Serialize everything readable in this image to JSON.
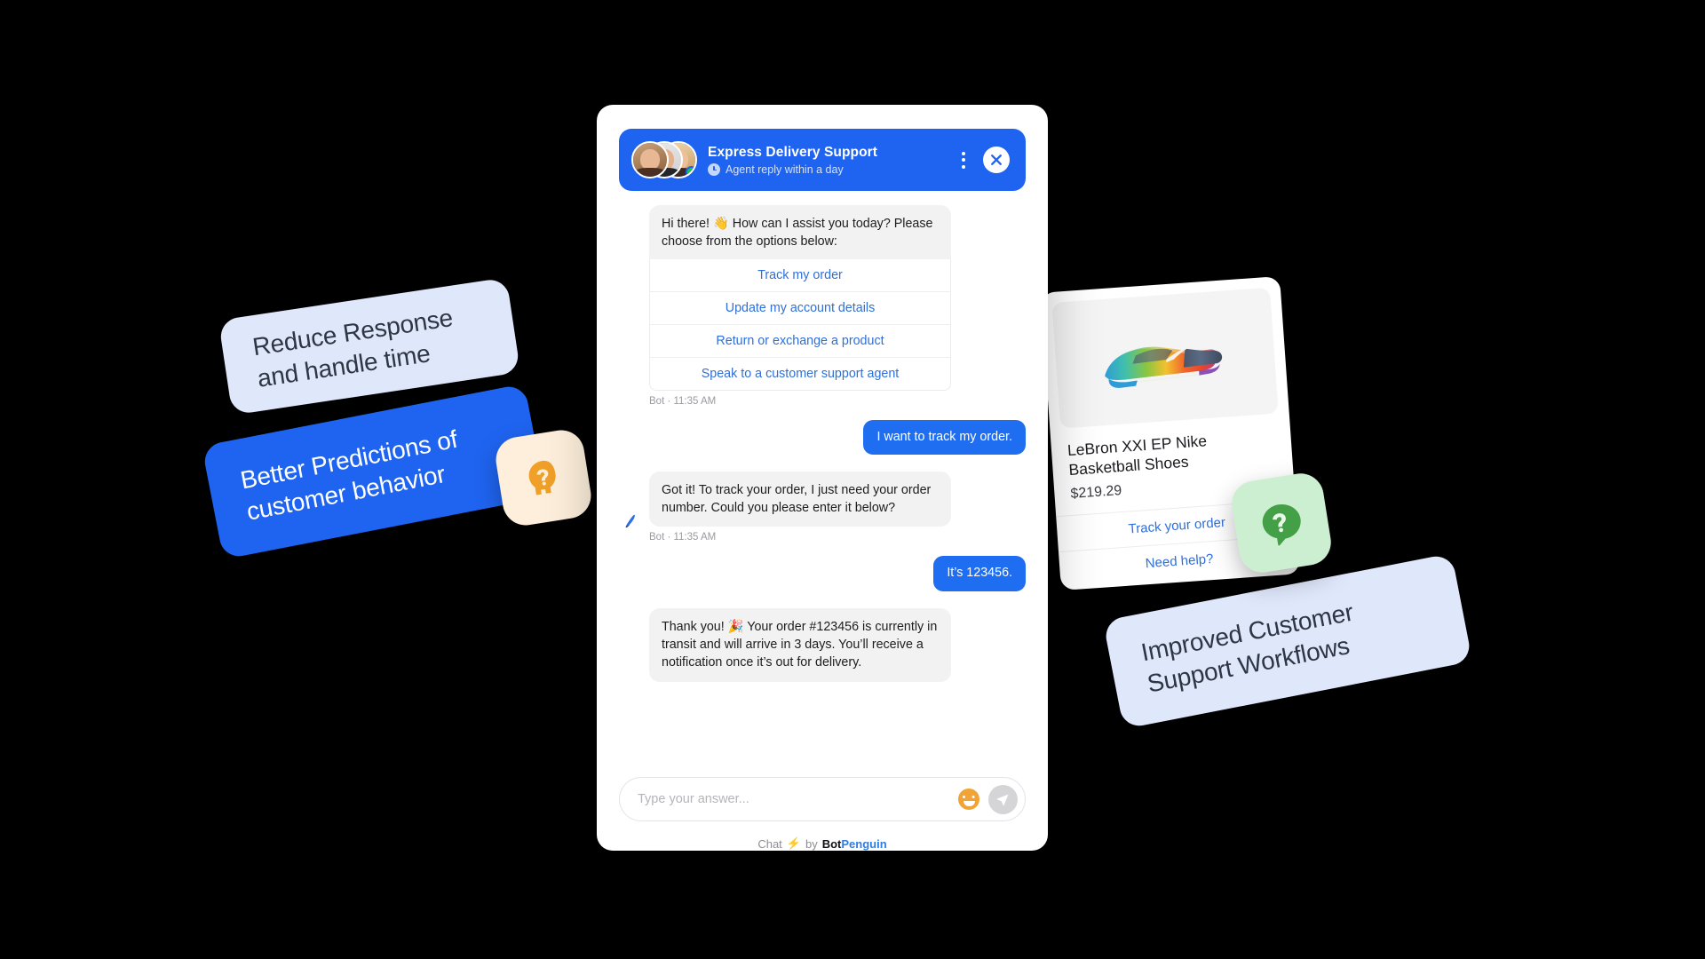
{
  "chat": {
    "header": {
      "title": "Express Delivery Support",
      "subtitle": "Agent reply within a day",
      "clock_icon": "clock-icon",
      "kebab_icon": "kebab-menu-icon",
      "close_icon": "close-icon",
      "avatars": [
        "agent-avatar-1",
        "agent-avatar-2",
        "agent-avatar-3"
      ],
      "online_status": "online",
      "accent_color": "#1f64f0"
    },
    "messages": [
      {
        "sender": "bot",
        "text": "Hi there! 👋 How can I assist you today? Please choose from the options below:",
        "options": [
          "Track my order",
          "Update my account details",
          "Return or exchange a product",
          "Speak to a customer support agent"
        ],
        "meta": "Bot · 11:35 AM"
      },
      {
        "sender": "user",
        "text": "I want to track my order."
      },
      {
        "sender": "bot",
        "text": "Got it! To track your order, I just need your order number. Could you please enter it below?",
        "meta": "Bot · 11:35 AM"
      },
      {
        "sender": "user",
        "text": "It’s 123456."
      },
      {
        "sender": "bot",
        "text": "Thank you! 🎉 Your order #123456 is currently in transit and will arrive in 3 days. You’ll receive a notification once it’s out for delivery."
      }
    ],
    "composer": {
      "placeholder": "Type your answer...",
      "value": "",
      "emoji_icon": "smiley-emoji-icon",
      "send_icon": "send-paper-plane-icon"
    },
    "footer": {
      "prefix": "Chat",
      "bolt_icon": "lightning-bolt-icon",
      "middle": "by",
      "brand_first": "Bot",
      "brand_second": "Penguin"
    }
  },
  "product_card": {
    "image_icon": "nike-sneaker-image",
    "title": "LeBron XXI EP Nike Basketball Shoes",
    "price": "$219.29",
    "actions": [
      "Track your order",
      "Need help?"
    ]
  },
  "floating_cards": [
    {
      "id": "reduce",
      "text": "Reduce Response and handle time",
      "bg": "#dfe7fb",
      "fg": "#2f3543"
    },
    {
      "id": "predictions",
      "text": "Better Predictions of customer behavior",
      "bg": "#1f64f0",
      "fg": "#ffffff"
    },
    {
      "id": "workflows",
      "text": "Improved Customer Support Workflows",
      "bg": "#dfe7fb",
      "fg": "#2f3543"
    }
  ],
  "icon_badges": [
    {
      "id": "head",
      "icon": "head-with-question-mark-icon",
      "bg": "#fdefdb",
      "fg": "#f0a028"
    },
    {
      "id": "question",
      "icon": "speech-bubble-question-mark-icon",
      "bg": "#cdefd1",
      "fg": "#43a047"
    }
  ]
}
